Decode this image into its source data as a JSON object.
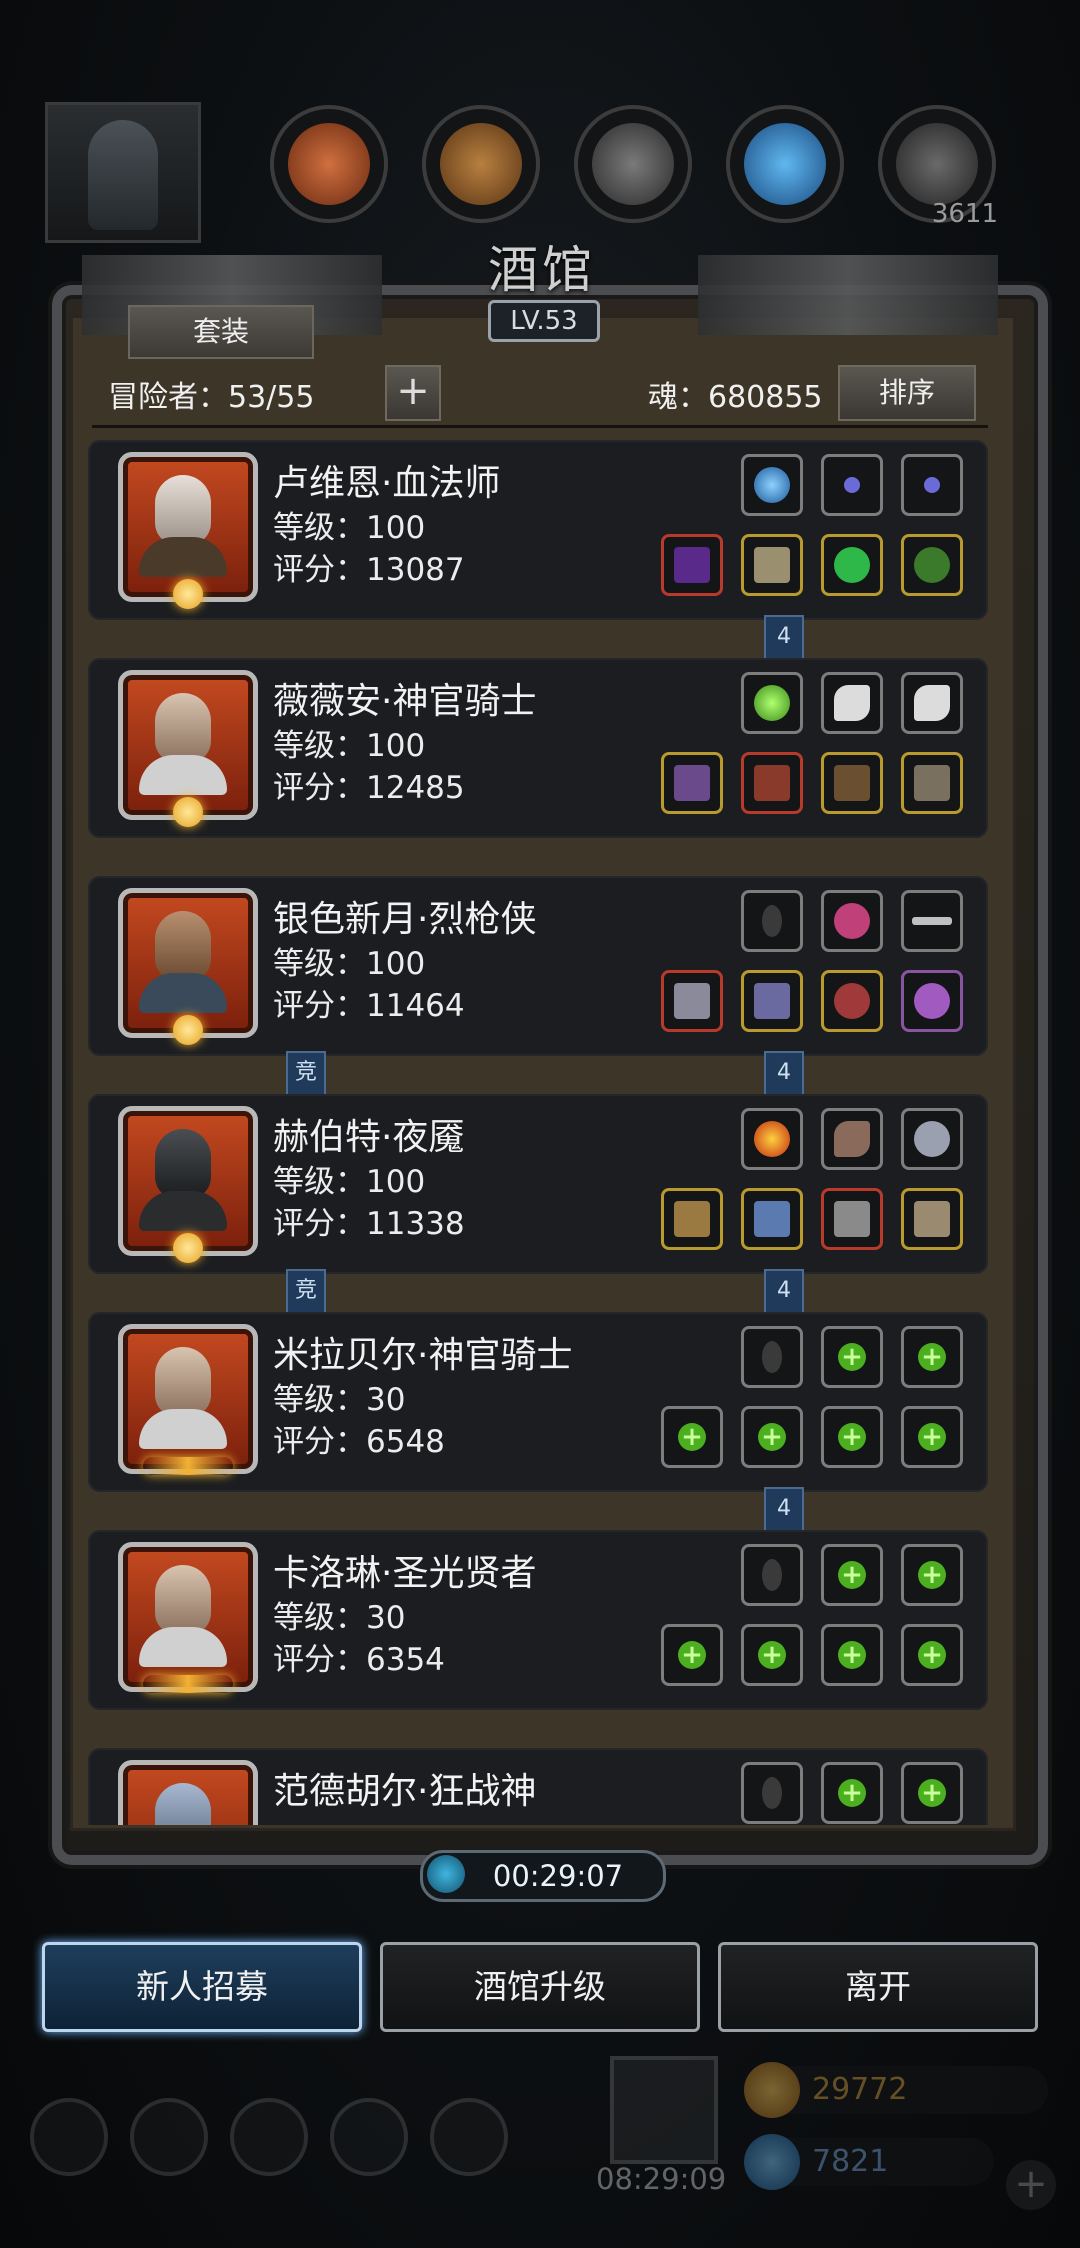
{
  "top_resources": [
    {
      "icon": "meat-resource-icon",
      "color": "#b35a2a"
    },
    {
      "icon": "wood-resource-icon",
      "color": "#a0652d"
    },
    {
      "icon": "iron-resource-icon",
      "color": "#6b6b6b"
    },
    {
      "icon": "crystal-resource-icon",
      "color": "#3d8fd0"
    },
    {
      "icon": "metal-ingot-resource-icon",
      "color": "#5a5a5a",
      "amount": "3611"
    }
  ],
  "panel": {
    "title": "酒馆",
    "level": "LV.53",
    "set_button": "套装",
    "adventurers_label": "冒险者：53/55",
    "soul_label": "魂：680855",
    "sort_button": "排序"
  },
  "heroes": [
    {
      "name": "卢维恩·血法师",
      "level": "等级：100",
      "score": "评分：13087",
      "portrait": "elf-mage",
      "slots_top": [
        {
          "type": "gem",
          "color": "#2f8ad8"
        },
        {
          "type": "amulet",
          "color": "#6b6bd8"
        },
        {
          "type": "amulet",
          "color": "#6b6bd8"
        }
      ],
      "slots_bottom": [
        {
          "border": "red",
          "color": "#5a2a8a"
        },
        {
          "border": "gold",
          "color": "#9a9070"
        },
        {
          "border": "gold",
          "color": "#2fb84a"
        },
        {
          "border": "gold",
          "color": "#3a7a2a"
        }
      ],
      "tag_right": "4"
    },
    {
      "name": "薇薇安·神官骑士",
      "level": "等级：100",
      "score": "评分：12485",
      "portrait": "priestess",
      "slots_top": [
        {
          "type": "gem",
          "color": "#6cd840"
        },
        {
          "type": "feather",
          "color": "#dcdcdc"
        },
        {
          "type": "feather",
          "color": "#dcdcdc"
        }
      ],
      "slots_bottom": [
        {
          "border": "gold",
          "color": "#6a4a8a"
        },
        {
          "border": "red",
          "color": "#8a3a2a"
        },
        {
          "border": "gold",
          "color": "#6a5030"
        },
        {
          "border": "gold",
          "color": "#7a7060"
        }
      ]
    },
    {
      "name": "银色新月·烈枪侠",
      "level": "等级：100",
      "score": "评分：11464",
      "portrait": "gunner",
      "slots_top": [
        {
          "type": "drop",
          "color": "#3a3a3a"
        },
        {
          "type": "ring",
          "color": "#c0407a"
        },
        {
          "type": "wand",
          "color": "#c0c0c0"
        }
      ],
      "slots_bottom": [
        {
          "border": "red",
          "color": "#8a8a9a"
        },
        {
          "border": "gold",
          "color": "#6a6aa0"
        },
        {
          "border": "gold",
          "color": "#a03a3a"
        },
        {
          "border": "purple",
          "color": "#a05ac0"
        }
      ],
      "tag_left": "竞",
      "tag_right": "4"
    },
    {
      "name": "赫伯特·夜魇",
      "level": "等级：100",
      "score": "评分：11338",
      "portrait": "dark-knight",
      "slots_top": [
        {
          "type": "gem",
          "color": "#e0502a"
        },
        {
          "type": "quill",
          "color": "#8a6a5a"
        },
        {
          "type": "charm",
          "color": "#9aa0b0"
        }
      ],
      "slots_bottom": [
        {
          "border": "gold",
          "color": "#9a7a40"
        },
        {
          "border": "gold",
          "color": "#5a7ab0"
        },
        {
          "border": "red",
          "color": "#8a8a8a"
        },
        {
          "border": "gold",
          "color": "#9a8a70"
        }
      ],
      "tag_left": "竞",
      "tag_right": "4"
    },
    {
      "name": "米拉贝尔·神官骑士",
      "level": "等级：30",
      "score": "评分：6548",
      "portrait": "priestess",
      "golden_badge": true,
      "slots_top": [
        {
          "type": "drop"
        },
        {
          "type": "empty"
        },
        {
          "type": "empty"
        }
      ],
      "slots_bottom": [
        {
          "type": "empty"
        },
        {
          "type": "empty"
        },
        {
          "type": "empty"
        },
        {
          "type": "empty"
        }
      ],
      "tag_right": "4"
    },
    {
      "name": "卡洛琳·圣光贤者",
      "level": "等级：30",
      "score": "评分：6354",
      "portrait": "priestess",
      "golden_badge": true,
      "slots_top": [
        {
          "type": "drop"
        },
        {
          "type": "empty"
        },
        {
          "type": "empty"
        }
      ],
      "slots_bottom": [
        {
          "type": "empty"
        },
        {
          "type": "empty"
        },
        {
          "type": "empty"
        },
        {
          "type": "empty"
        }
      ]
    },
    {
      "name": "范德胡尔·狂战神",
      "level": "",
      "score": "",
      "portrait": "berserker",
      "slots_top": [
        {
          "type": "drop"
        },
        {
          "type": "empty"
        },
        {
          "type": "empty"
        }
      ],
      "slots_bottom": []
    }
  ],
  "timer": "00:29:07",
  "buttons": {
    "recruit": "新人招募",
    "upgrade": "酒馆升级",
    "leave": "离开"
  },
  "footer": {
    "gift_timer": "08:29:09",
    "gold": "29772",
    "diamond": "7821",
    "icons": [
      "settings-icon",
      "star-icon",
      "helmet-icon",
      "mail-icon",
      "handshake-icon"
    ]
  }
}
